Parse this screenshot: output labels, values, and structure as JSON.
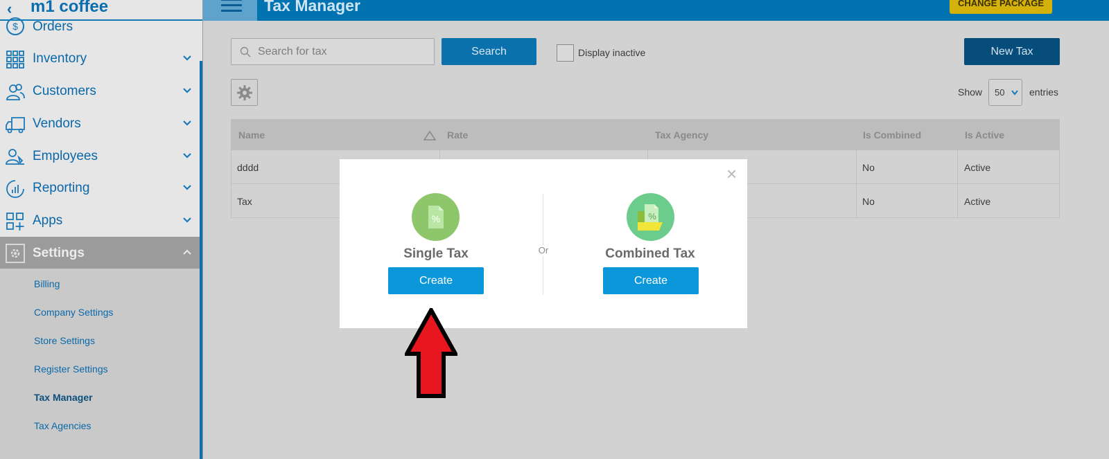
{
  "app": {
    "brand": "m1 coffee",
    "page_title": "Tax Manager",
    "change_package": "CHANGE PACKAGE"
  },
  "sidebar": {
    "items": [
      {
        "label": "Orders",
        "icon": "dollar-circle-icon"
      },
      {
        "label": "Inventory",
        "icon": "grid-icon"
      },
      {
        "label": "Customers",
        "icon": "users-icon"
      },
      {
        "label": "Vendors",
        "icon": "truck-icon"
      },
      {
        "label": "Employees",
        "icon": "employee-icon"
      },
      {
        "label": "Reporting",
        "icon": "chart-icon"
      },
      {
        "label": "Apps",
        "icon": "apps-icon"
      }
    ],
    "settings": {
      "label": "Settings",
      "subitems": [
        "Billing",
        "Company Settings",
        "Store Settings",
        "Register Settings",
        "Tax Manager",
        "Tax Agencies"
      ],
      "active": "Tax Manager"
    }
  },
  "toolbar": {
    "search_placeholder": "Search for tax",
    "search_label": "Search",
    "display_inactive_label": "Display inactive",
    "new_tax_label": "New Tax",
    "show_label": "Show",
    "entries_value": "50",
    "entries_label": "entries"
  },
  "table": {
    "columns": [
      "Name",
      "Rate",
      "Tax Agency",
      "Is Combined",
      "Is Active"
    ],
    "rows": [
      {
        "name": "dddd",
        "rate": "",
        "agency": "",
        "combined": "No",
        "active": "Active"
      },
      {
        "name": "Tax",
        "rate": "",
        "agency": "",
        "combined": "No",
        "active": "Active"
      }
    ]
  },
  "modal": {
    "close": "×",
    "single": {
      "title": "Single Tax",
      "button": "Create"
    },
    "or": "Or",
    "combined": {
      "title": "Combined Tax",
      "button": "Create"
    }
  },
  "colors": {
    "primary": "#0073b0",
    "create_button": "#0d97db",
    "single_icon": "#8ec76b",
    "combined_icon": "#6ccc8c",
    "annotation_arrow": "#e8161f"
  }
}
